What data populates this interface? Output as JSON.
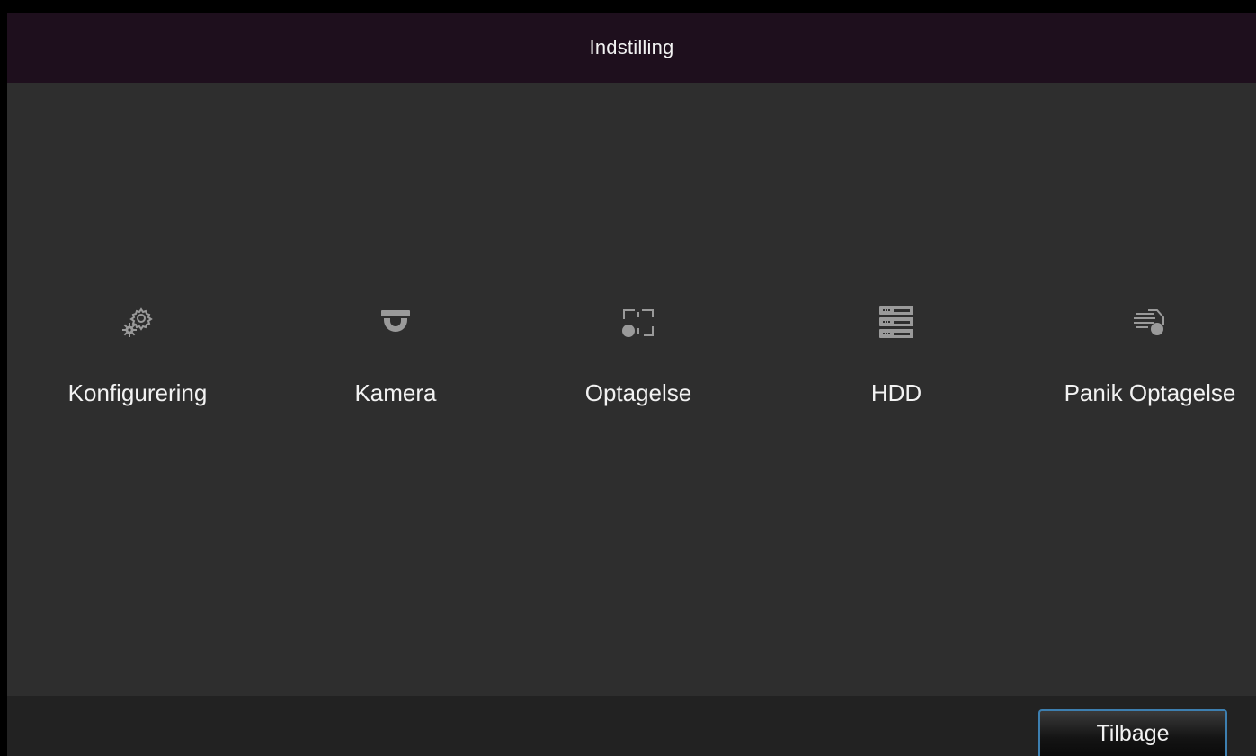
{
  "header": {
    "title": "Indstilling"
  },
  "menu": {
    "items": [
      {
        "label": "Konfigurering",
        "icon": "gears-icon"
      },
      {
        "label": "Kamera",
        "icon": "dome-camera-icon"
      },
      {
        "label": "Optagelse",
        "icon": "record-icon"
      },
      {
        "label": "HDD",
        "icon": "hdd-stack-icon"
      },
      {
        "label": "Panik Optagelse",
        "icon": "panic-record-icon"
      }
    ]
  },
  "footer": {
    "back_label": "Tilbage"
  },
  "colors": {
    "title_bar": "#1e0f1d",
    "background": "#2e2e2e",
    "footer": "#222222",
    "icon": "#9a9a9a",
    "text": "#f2f2f2",
    "button_border": "#3d7fb0"
  }
}
